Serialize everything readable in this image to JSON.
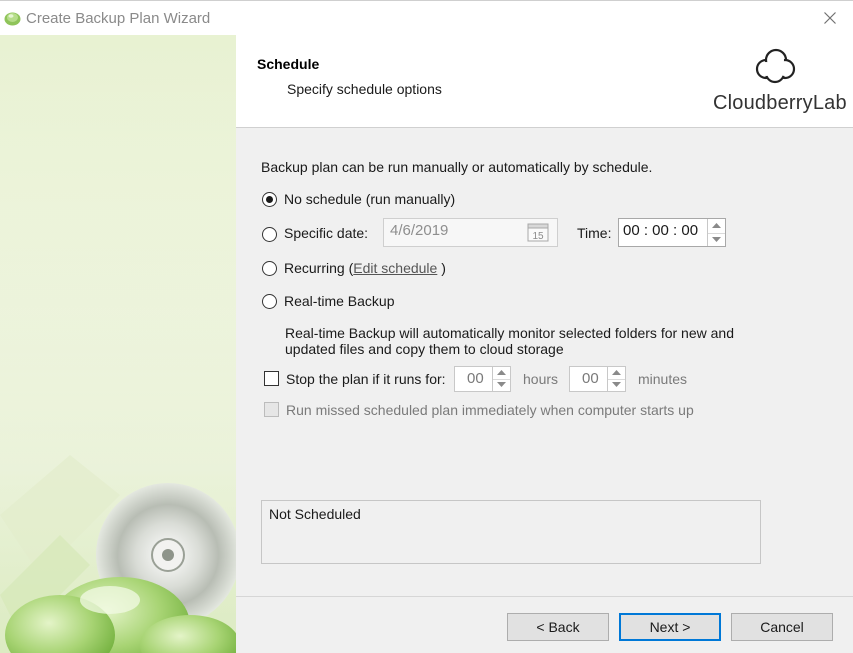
{
  "window": {
    "title": "Create Backup Plan Wizard"
  },
  "header": {
    "title": "Schedule",
    "subtitle": "Specify schedule options",
    "brand": "CloudberryLab"
  },
  "content": {
    "intro": "Backup plan can be run manually or automatically by schedule.",
    "options": {
      "no_schedule": {
        "label": "No schedule (run manually)",
        "selected": true
      },
      "specific_date": {
        "label": "Specific date:",
        "selected": false,
        "date_value": "4/6/2019",
        "calendar_day": "15",
        "time_label": "Time:",
        "time_value": "00 : 00 : 00"
      },
      "recurring": {
        "label": "Recurring",
        "open_paren": "(",
        "link": "Edit schedule",
        "close_paren": ")",
        "selected": false
      },
      "realtime": {
        "label": "Real-time Backup",
        "selected": false,
        "description_line1": "Real-time Backup will automatically monitor selected folders for new and",
        "description_line2": "updated files and copy them to cloud storage"
      }
    },
    "stop_plan": {
      "label": "Stop the plan if it runs for:",
      "checked": false,
      "hours_value": "00",
      "hours_label": "hours",
      "minutes_value": "00",
      "minutes_label": "minutes"
    },
    "run_missed": {
      "label": "Run missed scheduled plan immediately when computer starts up",
      "checked": false,
      "enabled": false
    },
    "status": "Not Scheduled"
  },
  "footer": {
    "back": "< Back",
    "next": "Next >",
    "cancel": "Cancel"
  },
  "colors": {
    "accent": "#0078d7",
    "sidebar_green": "#e8f2d2"
  }
}
